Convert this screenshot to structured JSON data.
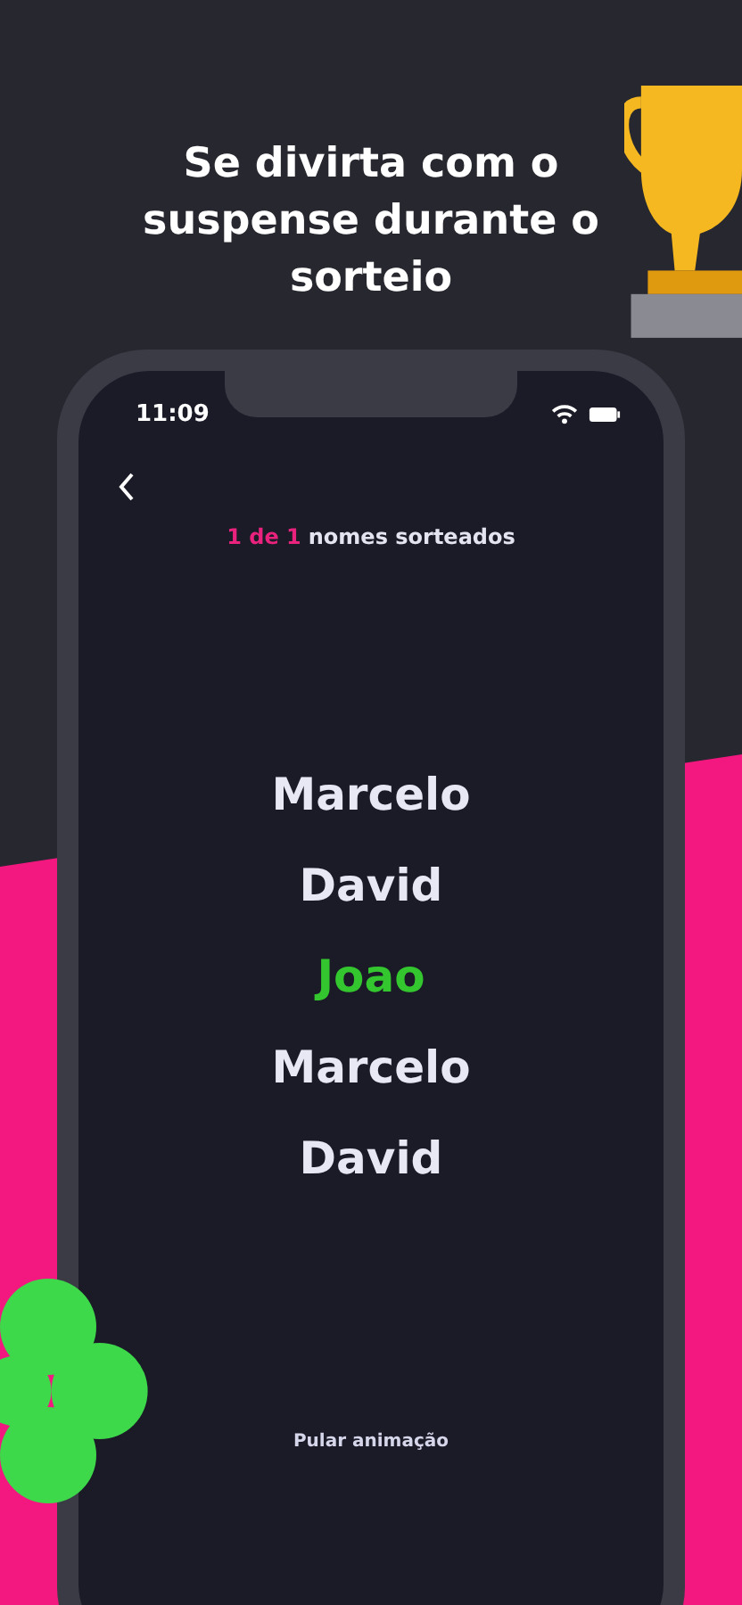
{
  "headline": "Se divirta com o suspense durante o sorteio",
  "status_bar": {
    "time": "11:09"
  },
  "counter": {
    "count": "1 de 1",
    "label": "nomes sorteados"
  },
  "names": [
    {
      "text": "Marcelo",
      "selected": false
    },
    {
      "text": "David",
      "selected": false
    },
    {
      "text": "Joao",
      "selected": true
    },
    {
      "text": "Marcelo",
      "selected": false
    },
    {
      "text": "David",
      "selected": false
    }
  ],
  "skip_link": "Pular animação"
}
